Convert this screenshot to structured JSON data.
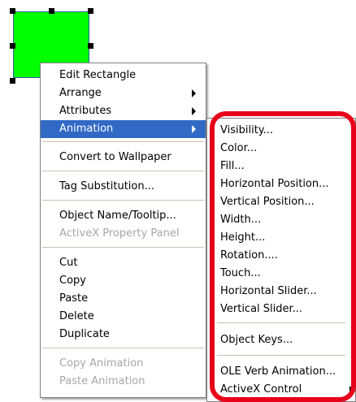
{
  "colors": {
    "shape_fill": "#00ff00",
    "highlight": "#316ac5",
    "callout": "#e8001a",
    "disabled_text": "#a7a6aa"
  },
  "context_menu": {
    "items": [
      {
        "label": "Edit Rectangle"
      },
      {
        "label": "Arrange",
        "submenu_arrow": true
      },
      {
        "label": "Attributes",
        "submenu_arrow": true
      },
      {
        "label": "Animation",
        "submenu_arrow": true,
        "highlighted": true
      },
      {
        "label": "Convert to Wallpaper"
      },
      {
        "label": "Tag Substitution..."
      },
      {
        "label": "Object Name/Tooltip..."
      },
      {
        "label": "ActiveX Property Panel",
        "disabled": true
      },
      {
        "label": "Cut"
      },
      {
        "label": "Copy"
      },
      {
        "label": "Paste"
      },
      {
        "label": "Delete"
      },
      {
        "label": "Duplicate"
      },
      {
        "label": "Copy Animation",
        "disabled": true
      },
      {
        "label": "Paste Animation",
        "disabled": true
      }
    ]
  },
  "animation_submenu": {
    "items": [
      {
        "label": "Visibility..."
      },
      {
        "label": "Color..."
      },
      {
        "label": "Fill..."
      },
      {
        "label": "Horizontal Position..."
      },
      {
        "label": "Vertical Position..."
      },
      {
        "label": "Width..."
      },
      {
        "label": "Height..."
      },
      {
        "label": "Rotation...."
      },
      {
        "label": "Touch..."
      },
      {
        "label": "Horizontal Slider..."
      },
      {
        "label": "Vertical Slider..."
      },
      {
        "label": "Object Keys..."
      },
      {
        "label": "OLE Verb Animation..."
      },
      {
        "label": "ActiveX Control",
        "submenu_arrow": true
      }
    ]
  }
}
